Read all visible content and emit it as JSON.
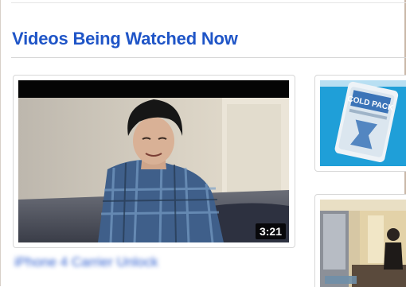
{
  "section": {
    "title": "Videos Being Watched Now"
  },
  "main_video": {
    "title": "iPhone 4 Carrier Unlock",
    "duration": "3:21",
    "thumbnail_icon": "video-thumbnail"
  },
  "side_videos": [
    {
      "thumbnail_label": "COLD PACK",
      "thumbnail_icon": "cold-pack-thumbnail"
    },
    {
      "thumbnail_icon": "room-thumbnail"
    }
  ],
  "colors": {
    "title": "#1f55c7",
    "link": "#2f5fd0",
    "card_border": "#d7d7d7"
  }
}
